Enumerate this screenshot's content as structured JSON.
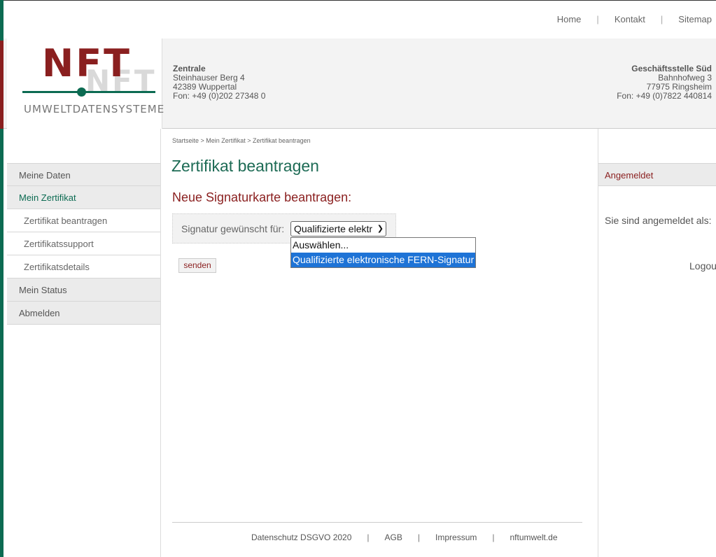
{
  "topnav": {
    "home": "Home",
    "kontakt": "Kontakt",
    "sitemap": "Sitemap",
    "separator": "|"
  },
  "logo": {
    "mark": "NFT",
    "mark_ghost": "NFT",
    "subtitle": "UMWELTDATENSYSTEME"
  },
  "address_left": {
    "title": "Zentrale",
    "street": "Steinhauser Berg 4",
    "city": "42389 Wuppertal",
    "phone": "Fon: +49 (0)202 27348 0"
  },
  "address_right": {
    "title": "Geschäftsstelle Süd",
    "street": "Bahnhofweg 3",
    "city": "77975 Ringsheim",
    "phone": "Fon: +49 (0)7822 440814"
  },
  "sidebar": {
    "items": [
      {
        "label": "Meine Daten"
      },
      {
        "label": "Mein Zertifikat"
      },
      {
        "label": "Zertifikat beantragen"
      },
      {
        "label": "Zertifikatssupport"
      },
      {
        "label": "Zertifikatsdetails"
      },
      {
        "label": "Mein Status"
      },
      {
        "label": "Abmelden"
      }
    ]
  },
  "main": {
    "breadcrumb": "Startseite > Mein Zertifikat > Zertifikat beantragen",
    "title": "Zertifikat beantragen",
    "subtitle": "Neue Signaturkarte beantragen:",
    "form": {
      "label": "Signatur gewünscht für:",
      "select_value": "Qualifizierte elektr",
      "options": [
        "Auswählen...",
        "Qualifizierte elektronische FERN-Signatur"
      ]
    },
    "submit": "senden"
  },
  "right": {
    "heading": "Angemeldet",
    "signed_in_text": "Sie sind angemeldet als:",
    "logout": "Logout"
  },
  "footer": {
    "links": [
      "Datenschutz DSGVO 2020",
      "AGB",
      "Impressum",
      "nftumwelt.de"
    ],
    "separator": "|"
  },
  "colors": {
    "brand_green": "#0c6b52",
    "brand_red": "#8a1f1f",
    "selection_blue": "#1e73d6"
  }
}
